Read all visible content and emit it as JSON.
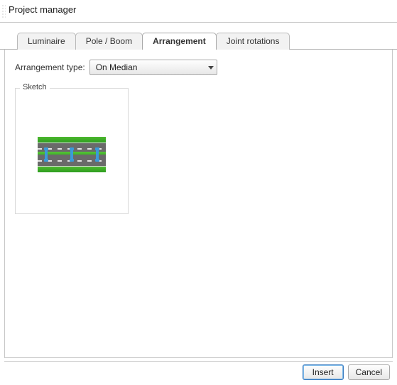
{
  "window": {
    "title": "Project manager"
  },
  "tabs": {
    "luminaire": "Luminaire",
    "pole_boom": "Pole / Boom",
    "arrangement": "Arrangement",
    "joint_rotations": "Joint rotations",
    "active": "arrangement"
  },
  "arrangement": {
    "type_label": "Arrangement type:",
    "type_value": "On Median",
    "sketch_label": "Sketch"
  },
  "buttons": {
    "insert": "Insert",
    "cancel": "Cancel"
  }
}
